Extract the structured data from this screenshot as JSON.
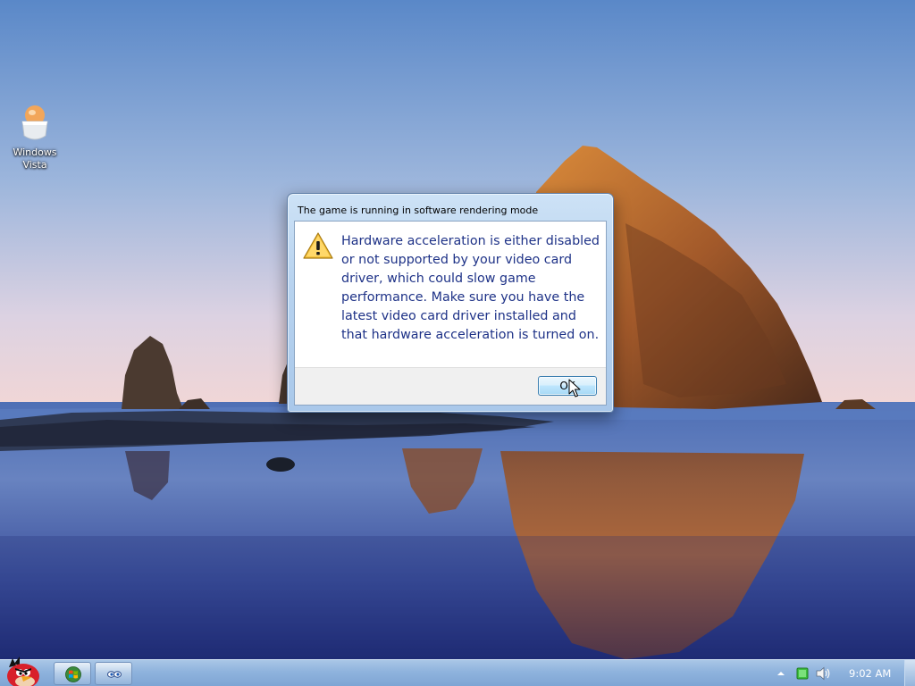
{
  "desktop": {
    "icons": [
      {
        "label": "Windows\nVista",
        "icon": "windows-vista-egg-icon"
      }
    ]
  },
  "dialog": {
    "title": "The game is running in software rendering mode",
    "icon": "warning-icon",
    "message": "Hardware acceleration is either disabled or not supported by your video card driver, which could slow game performance. Make sure you have the latest video card driver installed and that hardware acceleration is turned on.",
    "ok_label": "OK"
  },
  "taskbar": {
    "start_icon": "angry-bird-start-icon",
    "buttons": [
      {
        "icon": "windows-flag-icon"
      },
      {
        "icon": "eyes-icon"
      }
    ],
    "tray": {
      "icons": [
        "show-hidden-icons-arrow",
        "network-icon",
        "volume-icon"
      ],
      "clock": "9:02 AM"
    }
  },
  "colors": {
    "message_text": "#1e3287",
    "taskbar": "#8fb3dd",
    "sky_top": "#5a88c8",
    "sky_horizon": "#f1d6d6"
  }
}
